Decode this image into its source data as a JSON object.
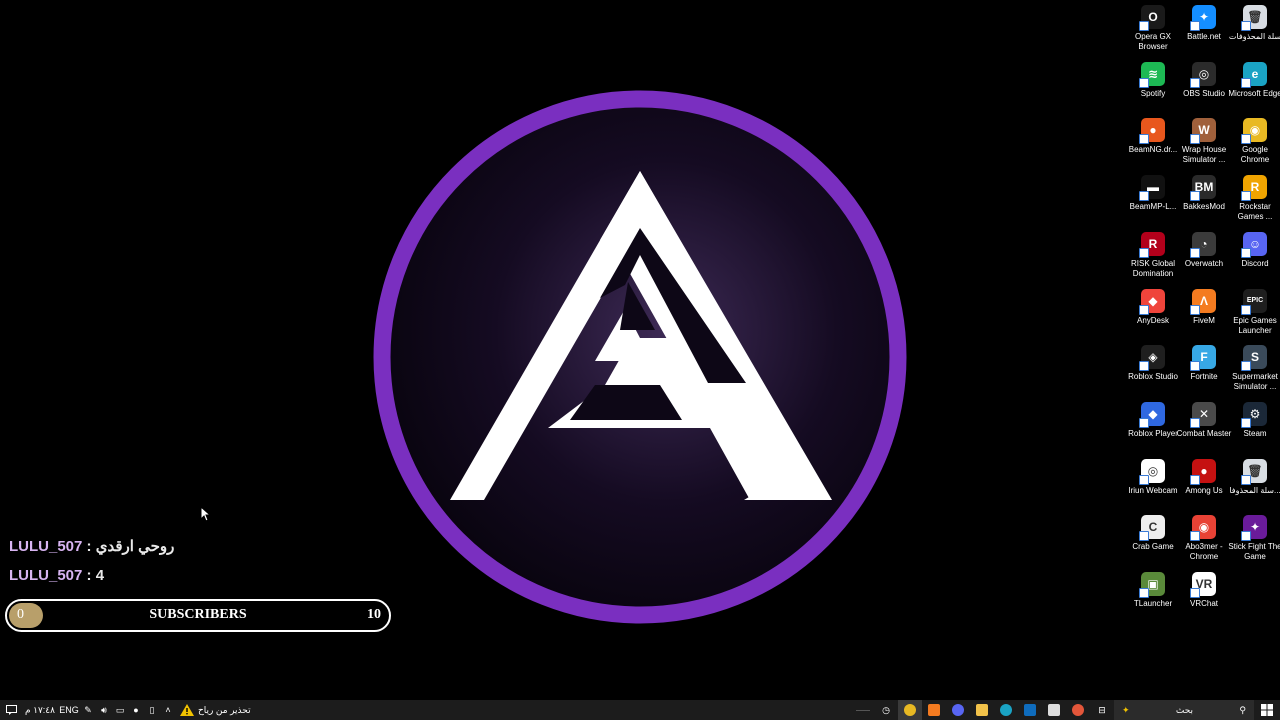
{
  "desktop": {
    "icons": [
      {
        "label": "Opera GX Browser",
        "icon": "opera-gx-icon",
        "color": "#1a1a1a",
        "glyph": "O"
      },
      {
        "label": "Battle.net",
        "icon": "battlenet-icon",
        "color": "#148eff",
        "glyph": "✦"
      },
      {
        "label": "سلة المحذوفات",
        "icon": "recycle-bin-icon",
        "color": "#d8dde3",
        "glyph": "🗑"
      },
      {
        "label": "Spotify",
        "icon": "spotify-icon",
        "color": "#1db954",
        "glyph": "≋"
      },
      {
        "label": "OBS Studio",
        "icon": "obs-icon",
        "color": "#2b2b2b",
        "glyph": "◎"
      },
      {
        "label": "Microsoft Edge",
        "icon": "edge-icon",
        "color": "#1aa3c4",
        "glyph": "e"
      },
      {
        "label": "BeamNG.dr...",
        "icon": "beamng-icon",
        "color": "#e8571d",
        "glyph": "●"
      },
      {
        "label": "Wrap House Simulator ...",
        "icon": "wrap-house-icon",
        "color": "#a0603b",
        "glyph": "W"
      },
      {
        "label": "Google Chrome",
        "icon": "chrome-icon",
        "color": "#e8b923",
        "glyph": "◉"
      },
      {
        "label": "BeamMP-L...",
        "icon": "beammp-icon",
        "color": "#111111",
        "glyph": "▬"
      },
      {
        "label": "BakkesMod",
        "icon": "bakkesmod-icon",
        "color": "#2a2a2a",
        "glyph": "BM"
      },
      {
        "label": "Rockstar Games ...",
        "icon": "rockstar-icon",
        "color": "#f0a400",
        "glyph": "R"
      },
      {
        "label": "RISK Global Domination",
        "icon": "risk-icon",
        "color": "#b3001b",
        "glyph": "R"
      },
      {
        "label": "Overwatch",
        "icon": "overwatch-icon",
        "color": "#3b3b3b",
        "glyph": "◔"
      },
      {
        "label": "Discord",
        "icon": "discord-icon",
        "color": "#5865f2",
        "glyph": "☺"
      },
      {
        "label": "AnyDesk",
        "icon": "anydesk-icon",
        "color": "#ef443b",
        "glyph": "◆"
      },
      {
        "label": "FiveM",
        "icon": "fivem-icon",
        "color": "#f47b20",
        "glyph": "Λ"
      },
      {
        "label": "Epic Games Launcher",
        "icon": "epic-games-icon",
        "color": "#1e1e1e",
        "glyph": "EPIC"
      },
      {
        "label": "Roblox Studio",
        "icon": "roblox-studio-icon",
        "color": "#1f1f1f",
        "glyph": "◈"
      },
      {
        "label": "Fortnite",
        "icon": "fortnite-icon",
        "color": "#37a8e5",
        "glyph": "F"
      },
      {
        "label": "Supermarket Simulator ...",
        "icon": "supermarket-sim-icon",
        "color": "#3a4a5a",
        "glyph": "S"
      },
      {
        "label": "Roblox Player",
        "icon": "roblox-player-icon",
        "color": "#2f68e0",
        "glyph": "◆"
      },
      {
        "label": "Combat Master",
        "icon": "combat-master-icon",
        "color": "#4a4a4a",
        "glyph": "✕"
      },
      {
        "label": "Steam",
        "icon": "steam-icon",
        "color": "#1b2838",
        "glyph": "⚙"
      },
      {
        "label": "Iriun Webcam",
        "icon": "iriun-webcam-icon",
        "color": "#ffffff",
        "glyph": "◎"
      },
      {
        "label": "Among Us",
        "icon": "among-us-icon",
        "color": "#c51111",
        "glyph": "●"
      },
      {
        "label": "سلة المحذوفا...",
        "icon": "recycle-bin-2-icon",
        "color": "#d8dde3",
        "glyph": "🗑"
      },
      {
        "label": "Crab Game",
        "icon": "crab-game-icon",
        "color": "#eeeeee",
        "glyph": "C"
      },
      {
        "label": "Abo3mer - Chrome",
        "icon": "chrome-profile-icon",
        "color": "#e84235",
        "glyph": "◉"
      },
      {
        "label": "Stick Fight The Game",
        "icon": "stick-fight-icon",
        "color": "#6a1b9a",
        "glyph": "✦"
      },
      {
        "label": "TLauncher",
        "icon": "tlauncher-icon",
        "color": "#5a8a3a",
        "glyph": "▣"
      },
      {
        "label": "VRChat",
        "icon": "vrchat-icon",
        "color": "#ffffff",
        "glyph": "VR"
      }
    ]
  },
  "chat": {
    "messages": [
      {
        "user": "LULU_507",
        "separator": " : ",
        "text": "روحي ارقدي"
      },
      {
        "user": "LULU_507",
        "separator": " : ",
        "text": "4"
      }
    ]
  },
  "subscriber_goal": {
    "current": "0",
    "label": "SUBSCRIBERS",
    "goal": "10",
    "progress": 0.09
  },
  "taskbar": {
    "search_placeholder": "بحث",
    "weather_warning": "تحذير من رياح",
    "language": "ENG",
    "clock": "١٧:٤٨ م"
  },
  "colors": {
    "ring": "#7a2fc0",
    "logo_bg": "#1a0f2a",
    "accent_user": "#d8b4f2",
    "sub_fill": "#b89f6a"
  }
}
